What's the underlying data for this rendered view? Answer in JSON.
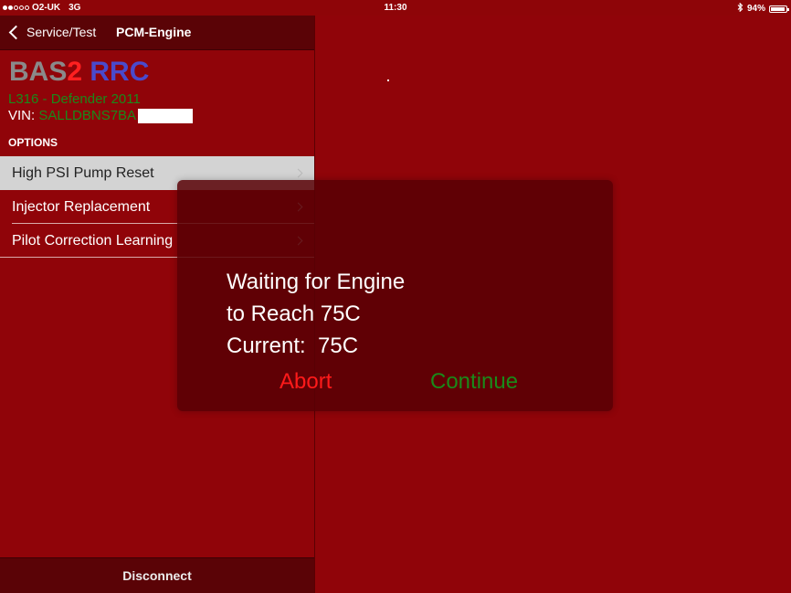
{
  "status_bar": {
    "carrier": "O2-UK",
    "network": "3G",
    "time": "11:30",
    "battery": "94%",
    "battery_level": 0.94,
    "signal_bars_filled": 2,
    "signal_bars_total": 5,
    "bluetooth_icon": "bluetooth-icon"
  },
  "nav": {
    "back_label": "Service/Test",
    "title": "PCM-Engine"
  },
  "brand": {
    "part1": "BAS",
    "part2": "2",
    "part3": " RRC"
  },
  "vehicle": {
    "model": "L316 - Defender 2011",
    "vin_label": "VIN: ",
    "vin_value": "SALLDBNS7BA"
  },
  "options_label": "OPTIONS",
  "options": [
    {
      "label": "High PSI Pump Reset",
      "selected": true
    },
    {
      "label": "Injector Replacement",
      "selected": false
    },
    {
      "label": "Pilot Correction Learning",
      "selected": false
    }
  ],
  "bottom": {
    "disconnect_label": "Disconnect"
  },
  "modal": {
    "line1": "Waiting for Engine",
    "line2": "to Reach 75C",
    "line3": "Current:  75C",
    "abort_label": "Abort",
    "continue_label": "Continue"
  },
  "colors": {
    "background": "#900409",
    "bar": "#5a0306",
    "abort": "#ff1a1a",
    "continue": "#1a8a1a"
  }
}
